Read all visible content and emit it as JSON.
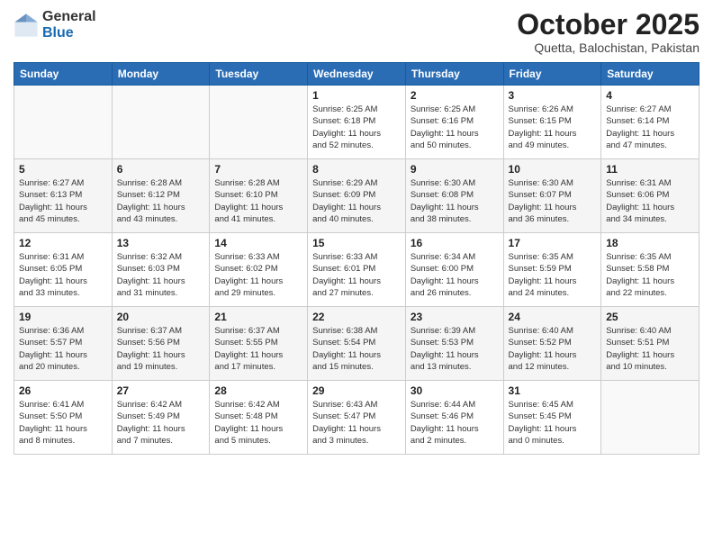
{
  "logo": {
    "general": "General",
    "blue": "Blue"
  },
  "header": {
    "month": "October 2025",
    "location": "Quetta, Balochistan, Pakistan"
  },
  "weekdays": [
    "Sunday",
    "Monday",
    "Tuesday",
    "Wednesday",
    "Thursday",
    "Friday",
    "Saturday"
  ],
  "weeks": [
    [
      {
        "day": "",
        "detail": ""
      },
      {
        "day": "",
        "detail": ""
      },
      {
        "day": "",
        "detail": ""
      },
      {
        "day": "1",
        "detail": "Sunrise: 6:25 AM\nSunset: 6:18 PM\nDaylight: 11 hours\nand 52 minutes."
      },
      {
        "day": "2",
        "detail": "Sunrise: 6:25 AM\nSunset: 6:16 PM\nDaylight: 11 hours\nand 50 minutes."
      },
      {
        "day": "3",
        "detail": "Sunrise: 6:26 AM\nSunset: 6:15 PM\nDaylight: 11 hours\nand 49 minutes."
      },
      {
        "day": "4",
        "detail": "Sunrise: 6:27 AM\nSunset: 6:14 PM\nDaylight: 11 hours\nand 47 minutes."
      }
    ],
    [
      {
        "day": "5",
        "detail": "Sunrise: 6:27 AM\nSunset: 6:13 PM\nDaylight: 11 hours\nand 45 minutes."
      },
      {
        "day": "6",
        "detail": "Sunrise: 6:28 AM\nSunset: 6:12 PM\nDaylight: 11 hours\nand 43 minutes."
      },
      {
        "day": "7",
        "detail": "Sunrise: 6:28 AM\nSunset: 6:10 PM\nDaylight: 11 hours\nand 41 minutes."
      },
      {
        "day": "8",
        "detail": "Sunrise: 6:29 AM\nSunset: 6:09 PM\nDaylight: 11 hours\nand 40 minutes."
      },
      {
        "day": "9",
        "detail": "Sunrise: 6:30 AM\nSunset: 6:08 PM\nDaylight: 11 hours\nand 38 minutes."
      },
      {
        "day": "10",
        "detail": "Sunrise: 6:30 AM\nSunset: 6:07 PM\nDaylight: 11 hours\nand 36 minutes."
      },
      {
        "day": "11",
        "detail": "Sunrise: 6:31 AM\nSunset: 6:06 PM\nDaylight: 11 hours\nand 34 minutes."
      }
    ],
    [
      {
        "day": "12",
        "detail": "Sunrise: 6:31 AM\nSunset: 6:05 PM\nDaylight: 11 hours\nand 33 minutes."
      },
      {
        "day": "13",
        "detail": "Sunrise: 6:32 AM\nSunset: 6:03 PM\nDaylight: 11 hours\nand 31 minutes."
      },
      {
        "day": "14",
        "detail": "Sunrise: 6:33 AM\nSunset: 6:02 PM\nDaylight: 11 hours\nand 29 minutes."
      },
      {
        "day": "15",
        "detail": "Sunrise: 6:33 AM\nSunset: 6:01 PM\nDaylight: 11 hours\nand 27 minutes."
      },
      {
        "day": "16",
        "detail": "Sunrise: 6:34 AM\nSunset: 6:00 PM\nDaylight: 11 hours\nand 26 minutes."
      },
      {
        "day": "17",
        "detail": "Sunrise: 6:35 AM\nSunset: 5:59 PM\nDaylight: 11 hours\nand 24 minutes."
      },
      {
        "day": "18",
        "detail": "Sunrise: 6:35 AM\nSunset: 5:58 PM\nDaylight: 11 hours\nand 22 minutes."
      }
    ],
    [
      {
        "day": "19",
        "detail": "Sunrise: 6:36 AM\nSunset: 5:57 PM\nDaylight: 11 hours\nand 20 minutes."
      },
      {
        "day": "20",
        "detail": "Sunrise: 6:37 AM\nSunset: 5:56 PM\nDaylight: 11 hours\nand 19 minutes."
      },
      {
        "day": "21",
        "detail": "Sunrise: 6:37 AM\nSunset: 5:55 PM\nDaylight: 11 hours\nand 17 minutes."
      },
      {
        "day": "22",
        "detail": "Sunrise: 6:38 AM\nSunset: 5:54 PM\nDaylight: 11 hours\nand 15 minutes."
      },
      {
        "day": "23",
        "detail": "Sunrise: 6:39 AM\nSunset: 5:53 PM\nDaylight: 11 hours\nand 13 minutes."
      },
      {
        "day": "24",
        "detail": "Sunrise: 6:40 AM\nSunset: 5:52 PM\nDaylight: 11 hours\nand 12 minutes."
      },
      {
        "day": "25",
        "detail": "Sunrise: 6:40 AM\nSunset: 5:51 PM\nDaylight: 11 hours\nand 10 minutes."
      }
    ],
    [
      {
        "day": "26",
        "detail": "Sunrise: 6:41 AM\nSunset: 5:50 PM\nDaylight: 11 hours\nand 8 minutes."
      },
      {
        "day": "27",
        "detail": "Sunrise: 6:42 AM\nSunset: 5:49 PM\nDaylight: 11 hours\nand 7 minutes."
      },
      {
        "day": "28",
        "detail": "Sunrise: 6:42 AM\nSunset: 5:48 PM\nDaylight: 11 hours\nand 5 minutes."
      },
      {
        "day": "29",
        "detail": "Sunrise: 6:43 AM\nSunset: 5:47 PM\nDaylight: 11 hours\nand 3 minutes."
      },
      {
        "day": "30",
        "detail": "Sunrise: 6:44 AM\nSunset: 5:46 PM\nDaylight: 11 hours\nand 2 minutes."
      },
      {
        "day": "31",
        "detail": "Sunrise: 6:45 AM\nSunset: 5:45 PM\nDaylight: 11 hours\nand 0 minutes."
      },
      {
        "day": "",
        "detail": ""
      }
    ]
  ]
}
